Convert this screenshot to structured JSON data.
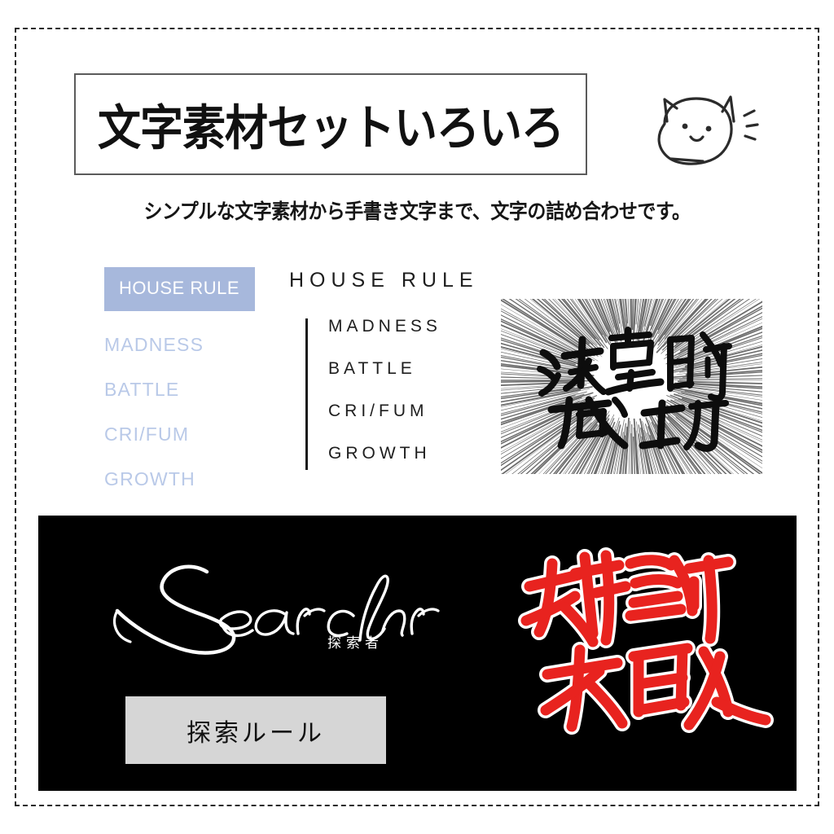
{
  "page": {
    "background": "#ffffff",
    "frame_style": "dashed",
    "frame_color": "#2b2b2b"
  },
  "header": {
    "title": "文字素材セットいろいろ",
    "subtitle": "シンプルな文字素材から手書き文字まで、文字の詰め合わせです。",
    "cat_icon_name": "cat-doodle-icon"
  },
  "colors": {
    "badge_blue": "#a7b8dc",
    "light_blue_text": "#b9c9e8",
    "black_panel": "#000000",
    "gray_button": "#d6d6d6",
    "red_brush": "#e8231f",
    "ink_black": "#1e1e1e"
  },
  "sample_sets": {
    "blue_column": {
      "badge_label": "HOUSE RULE",
      "items": [
        "MADNESS",
        "BATTLE",
        "CRI/FUM",
        "GROWTH"
      ]
    },
    "mono_column": {
      "heading": "HOUSE RULE",
      "items": [
        "MADNESS",
        "BATTLE",
        "CRI/FUM",
        "GROWTH"
      ]
    }
  },
  "brush_art": {
    "success": {
      "text": "決定的成功",
      "line1": "決定的",
      "line2": "成功",
      "style": "black-brush-on-speedlines"
    },
    "failure": {
      "text": "致命的失敗",
      "line1": "致命的",
      "line2": "失敗",
      "style": "red-brush-white-outline"
    }
  },
  "dark_panel": {
    "script_word": "Searcher",
    "script_subtitle": "探索者",
    "button_label": "探索ルール"
  }
}
